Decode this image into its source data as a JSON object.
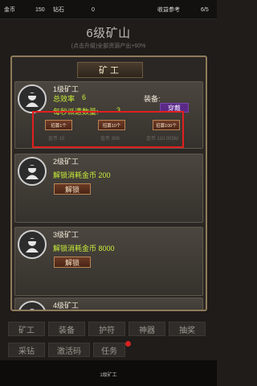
{
  "topbar": {
    "gold_label": "金币",
    "gold_value": "150",
    "diamond_label": "钻石",
    "diamond_value": "0",
    "income_label": "收益参考",
    "income_value": "6/5"
  },
  "header": {
    "title": "6级矿山",
    "subtitle": "(点击升级)全部资源产出+60%"
  },
  "panel": {
    "title": "矿工"
  },
  "miners": [
    {
      "level": "1级矿工",
      "efficiency_label": "总效率",
      "efficiency_value": "6",
      "equip_label": "装备:",
      "equip_button": "穿戴",
      "dispatch_label": "每秒派遣数量:",
      "dispatch_value": "3",
      "recruit": [
        {
          "label": "招募1个",
          "cost": "金币 15"
        },
        {
          "label": "招募10个",
          "cost": "金币 308"
        },
        {
          "label": "招募100个",
          "cost": "金币 110.055M"
        }
      ]
    },
    {
      "level": "2级矿工",
      "unlock_text": "解锁消耗金币 200",
      "unlock_button": "解锁"
    },
    {
      "level": "3级矿工",
      "unlock_text": "解锁消耗金币 8000",
      "unlock_button": "解锁"
    },
    {
      "level": "4级矿工"
    }
  ],
  "nav": {
    "row1": [
      "矿工",
      "装备",
      "护符",
      "神器",
      "抽奖"
    ],
    "row2": [
      "采钻",
      "激活码",
      "任务"
    ]
  },
  "footer": {
    "label": "1级矿工"
  },
  "colors": {
    "accent_green": "#c7ec3a",
    "highlight_red": "#e11f1f",
    "wear_purple": "#5a2a86"
  }
}
